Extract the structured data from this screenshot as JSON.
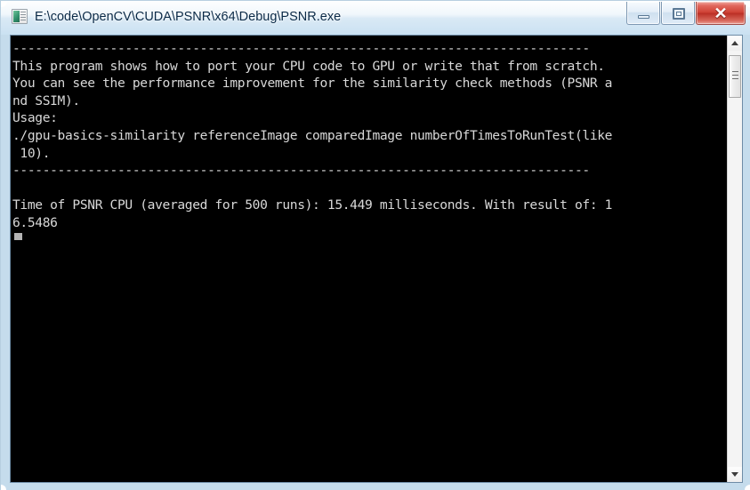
{
  "window": {
    "title": "E:\\code\\OpenCV\\CUDA\\PSNR\\x64\\Debug\\PSNR.exe",
    "icon": "console-app-icon",
    "frame_color": "#c5dcec",
    "titlebar_text_color": "#0b2a47"
  },
  "window_controls": {
    "minimize_label": "–",
    "maximize_label": "□",
    "close_label": "✕",
    "close_color": "#cf4235"
  },
  "console": {
    "background": "#000000",
    "foreground": "#d8d8d8",
    "lines": [
      "-----------------------------------------------------------------------------",
      "This program shows how to port your CPU code to GPU or write that from scratch.",
      "You can see the performance improvement for the similarity check methods (PSNR a",
      "nd SSIM).",
      "Usage:",
      "./gpu-basics-similarity referenceImage comparedImage numberOfTimesToRunTest(like",
      " 10).",
      "-----------------------------------------------------------------------------",
      "",
      "Time of PSNR CPU (averaged for 500 runs): 15.449 milliseconds. With result of: 1",
      "6.5486"
    ],
    "cursor": "block-cursor"
  },
  "scrollbar": {
    "up_arrow": "triangle-up-icon",
    "down_arrow": "triangle-down-icon",
    "thumb": "scroll-thumb"
  }
}
